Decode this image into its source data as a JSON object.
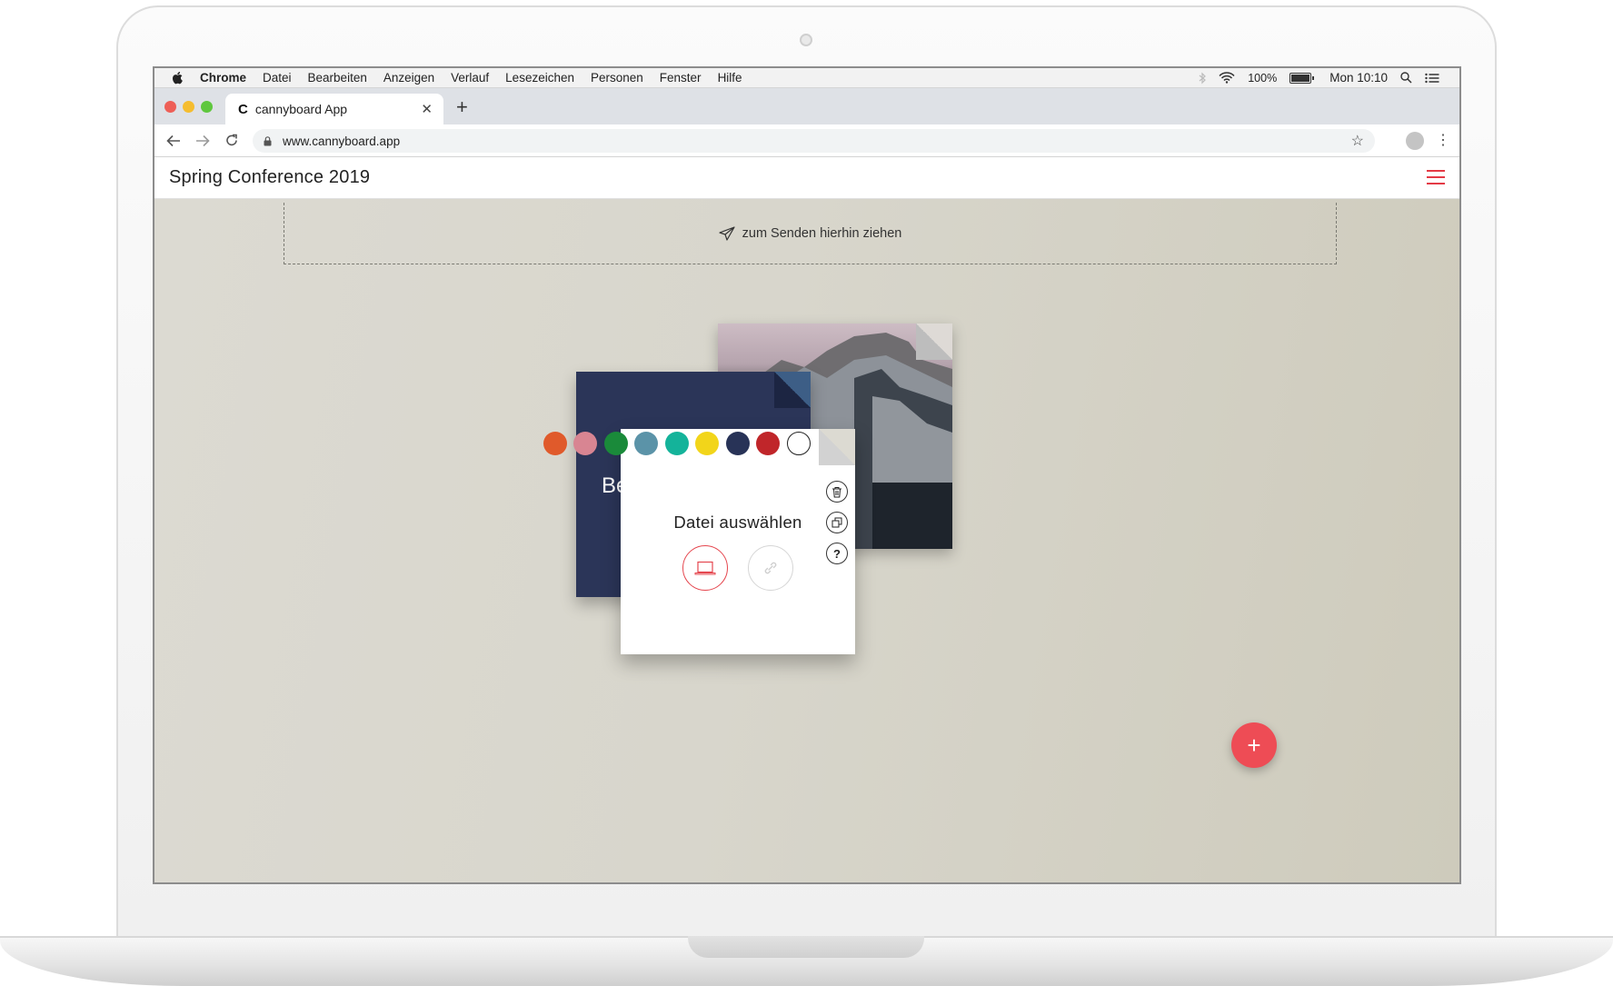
{
  "menubar": {
    "items": [
      "Chrome",
      "Datei",
      "Bearbeiten",
      "Anzeigen",
      "Verlauf",
      "Lesezeichen",
      "Personen",
      "Fenster",
      "Hilfe"
    ],
    "battery": "100%",
    "clock": "Mon 10:10"
  },
  "browser": {
    "tab_title": "cannyboard App",
    "tab_favicon": "C",
    "url": "www.cannyboard.app"
  },
  "app": {
    "title": "Spring Conference 2019",
    "dropzone_label": "zum Senden hierhin ziehen",
    "blue_card_text": "Be",
    "main_card_title": "Datei auswählen",
    "help_label": "?",
    "fab_label": "+"
  },
  "colors": {
    "accent": "#ee4c55",
    "swatches": [
      "#e05a2b",
      "#d88592",
      "#1a8a3a",
      "#5b93a8",
      "#14b39a",
      "#f2d51a",
      "#283357",
      "#c0262a",
      "#ffffff"
    ]
  },
  "icons": {
    "apple": "apple-icon",
    "bluetooth": "bluetooth-icon",
    "wifi": "wifi-icon",
    "battery": "battery-icon",
    "search": "spotlight-search-icon",
    "notifications": "notification-list-icon",
    "back": "back-arrow-icon",
    "forward": "forward-arrow-icon",
    "reload": "reload-icon",
    "lock": "lock-icon",
    "bookmark": "star-icon",
    "send": "paper-plane-icon",
    "delete": "trash-icon",
    "duplicate": "duplicate-icon",
    "laptop": "laptop-icon",
    "link": "link-icon"
  }
}
